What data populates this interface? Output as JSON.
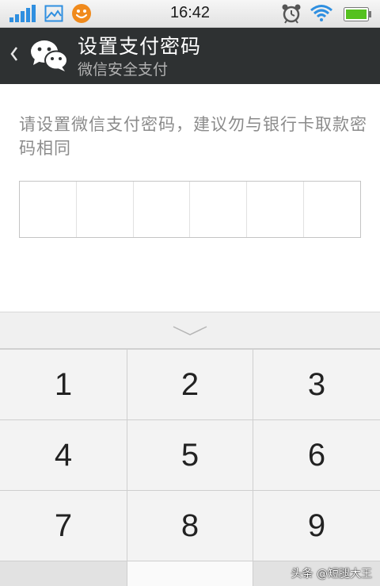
{
  "status_bar": {
    "time": "16:42",
    "icons": [
      "signal-icon",
      "gallery-icon",
      "smiley-notification-icon",
      "alarm-clock-icon",
      "wifi-icon",
      "battery-icon"
    ],
    "colors": {
      "signal": "#2f8fe0",
      "wifi": "#2f8fe0",
      "battery": "#55c11f",
      "smiley": "#f08a1c"
    }
  },
  "header": {
    "title": "设置支付密码",
    "subtitle": "微信安全支付",
    "back_icon": "chevron-left-icon",
    "logo_icon": "wechat-logo-icon",
    "background": "#2e3132"
  },
  "instruction": "请设置微信支付密码，建议勿与银行卡取款密码相同",
  "pin": {
    "length": 6
  },
  "keyboard": {
    "collapse_icon": "chevron-down-icon",
    "keys": [
      {
        "label": "1"
      },
      {
        "label": "2"
      },
      {
        "label": "3"
      },
      {
        "label": "4"
      },
      {
        "label": "5"
      },
      {
        "label": "6"
      },
      {
        "label": "7"
      },
      {
        "label": "8"
      },
      {
        "label": "9"
      }
    ]
  },
  "watermark": "头条 @短腿大王"
}
